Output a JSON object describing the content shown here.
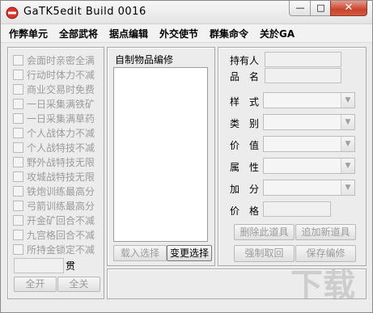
{
  "window": {
    "title": "GaTK5edit Build 0016",
    "controls": {
      "minimize": "—",
      "maximize": "□",
      "close": "✕"
    }
  },
  "menu": [
    "作弊单元",
    "全部武将",
    "据点编辑",
    "外交使节",
    "群集命令",
    "关於GA"
  ],
  "cheats": {
    "items": [
      "会面时亲密全满",
      "行动时体力不减",
      "商业交易时免费",
      "一日采集满铁矿",
      "一日采集满草药",
      "个人战体力不减",
      "个人战特技不减",
      "野外战特技无限",
      "攻城战特技无限",
      "铁炮训练最高分",
      "弓箭训练最高分",
      "开金矿回合不减",
      "九宫格回合不减",
      "所持金锁定不减"
    ],
    "money_unit": "贯",
    "select_all": "全开",
    "select_none": "全关"
  },
  "items_panel": {
    "title": "自制物品编修",
    "load_button": "载入选择",
    "change_button": "变更选择"
  },
  "editor": {
    "owner_label": "持有人",
    "name_label": "品　名",
    "style_label": "样　式",
    "category_label": "类　别",
    "value_label": "价　值",
    "attribute_label": "属　性",
    "bonus_label": "加　分",
    "price_label": "价　格",
    "delete_button": "删除此道具",
    "add_button": "追加新道具",
    "cancel_button": "强制取回",
    "save_button": "保存编修"
  },
  "watermark": "下载"
}
